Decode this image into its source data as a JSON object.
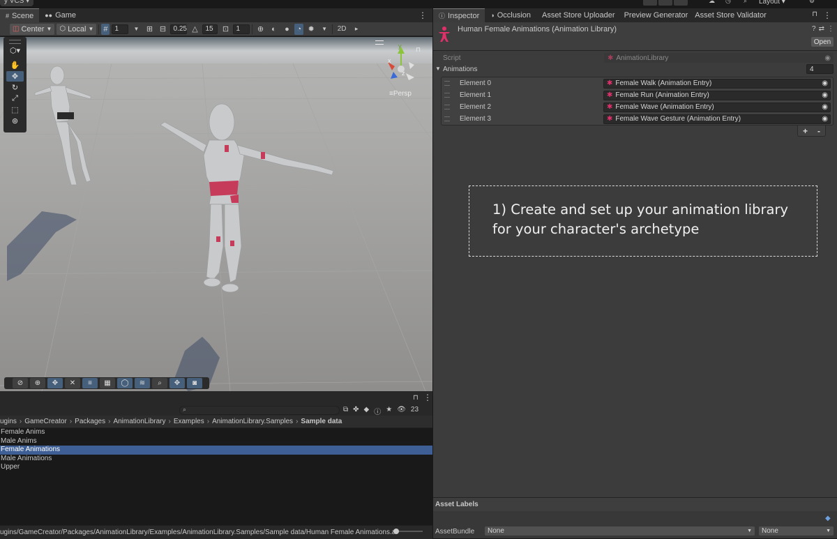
{
  "topbar": {
    "vcs_label": "y VCS ▾",
    "layout_label": "Layout ▾"
  },
  "scene_tabs": {
    "scene": "Scene",
    "game": "Game"
  },
  "scene_toolbar": {
    "pivot": "Center",
    "space": "Local",
    "grid_value": "1",
    "snap_value": "0.25",
    "rotate_snap": "15",
    "scale_snap": "1",
    "mode_2d": "2D"
  },
  "scene_view": {
    "projection_label": "≡Persp",
    "gizmo_y": "y",
    "gizmo_x": "x",
    "gizmo_z": "z"
  },
  "project": {
    "hidden_count": "23",
    "breadcrumb": [
      "ugins",
      "GameCreator",
      "Packages",
      "AnimationLibrary",
      "Examples",
      "AnimationLibrary.Samples",
      "Sample data"
    ],
    "items": [
      "Female Anims",
      "Male Anims",
      "Female Animations",
      "Male Animations",
      "Upper"
    ],
    "selected_index": 2,
    "path": "ugins/GameCreator/Packages/AnimationLibrary/Examples/AnimationLibrary.Samples/Sample data/Human Female Animations.asset"
  },
  "inspector_tabs": [
    "Inspector",
    "Occlusion",
    "Asset Store Uploader",
    "Preview Generator",
    "Asset Store Validator"
  ],
  "inspector": {
    "title": "Human Female Animations (Animation Library)",
    "open_label": "Open",
    "script_label": "Script",
    "script_value": "AnimationLibrary",
    "animations_label": "Animations",
    "animations_count": "4",
    "elements": [
      {
        "label": "Element 0",
        "value": "Female Walk (Animation Entry)"
      },
      {
        "label": "Element 1",
        "value": "Female Run (Animation Entry)"
      },
      {
        "label": "Element 2",
        "value": "Female Wave (Animation Entry)"
      },
      {
        "label": "Element 3",
        "value": "Female Wave Gesture (Animation Entry)"
      }
    ],
    "add_label": "+",
    "remove_label": "-",
    "annotation": "1) Create and set up your animation library for your character's archetype",
    "asset_labels": "Asset Labels",
    "assetbundle_label": "AssetBundle",
    "assetbundle_value": "None",
    "variant_value": "None"
  },
  "colors": {
    "accent": "#46607c",
    "selection": "#3e5f96",
    "asset_icon": "#e0306a",
    "scene_sky": "#c4c8cc",
    "scene_ground": "#9c9b99"
  }
}
